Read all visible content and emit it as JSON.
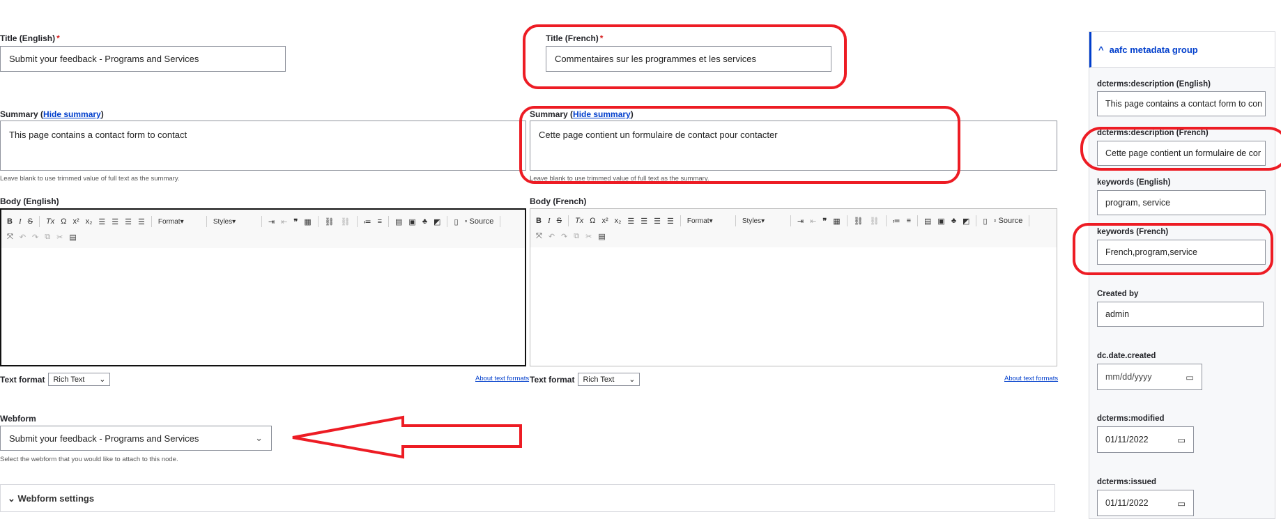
{
  "title_en": {
    "label": "Title (English)",
    "required": "*",
    "value": "Submit your feedback - Programs and Services"
  },
  "title_fr": {
    "label": "Title (French)",
    "required": "*",
    "value": "Commentaires sur les programmes et les services"
  },
  "summary_en": {
    "label": "Summary (",
    "link": "Hide summary",
    "close": ")",
    "value": "This page contains a contact form to contact",
    "help": "Leave blank to use trimmed value of full text as the summary."
  },
  "summary_fr": {
    "label": "Summary (",
    "link": "Hide summary",
    "close": ")",
    "value": "Cette page contient un formulaire de contact pour contacter",
    "help": "Leave blank to use trimmed value of full text as the summary."
  },
  "body_en": {
    "label": "Body (English)"
  },
  "body_fr": {
    "label": "Body (French)"
  },
  "toolbar": {
    "bold": "B",
    "italic": "I",
    "strike": "S",
    "removeformat": "Tx",
    "omega": "Ω",
    "sup": "x²",
    "sub": "x₂",
    "format": "Format",
    "styles": "Styles",
    "source": "Source"
  },
  "text_format": {
    "label": "Text format",
    "value": "Rich Text",
    "about": "About text formats"
  },
  "webform": {
    "label": "Webform",
    "value": "Submit your feedback - Programs and Services",
    "help": "Select the webform that you would like to attach to this node.",
    "settings": "Webform settings"
  },
  "sidebar": {
    "group": "aafc metadata group",
    "desc_en": {
      "label": "dcterms:description (English)",
      "value": "This page contains a contact form to con"
    },
    "desc_fr": {
      "label": "dcterms:description (French)",
      "value": "Cette page contient un formulaire de cor"
    },
    "kw_en": {
      "label": "keywords (English)",
      "value": "program, service"
    },
    "kw_fr": {
      "label": "keywords (French)",
      "value": "French,program,service"
    },
    "created_by": {
      "label": "Created by",
      "value": "admin"
    },
    "date_created": {
      "label": "dc.date.created",
      "value": "mm/dd/yyyy"
    },
    "modified": {
      "label": "dcterms:modified",
      "value": "01/11/2022"
    },
    "issued": {
      "label": "dcterms:issued",
      "value": "01/11/2022"
    }
  },
  "annotation_color": "#ed1c24"
}
